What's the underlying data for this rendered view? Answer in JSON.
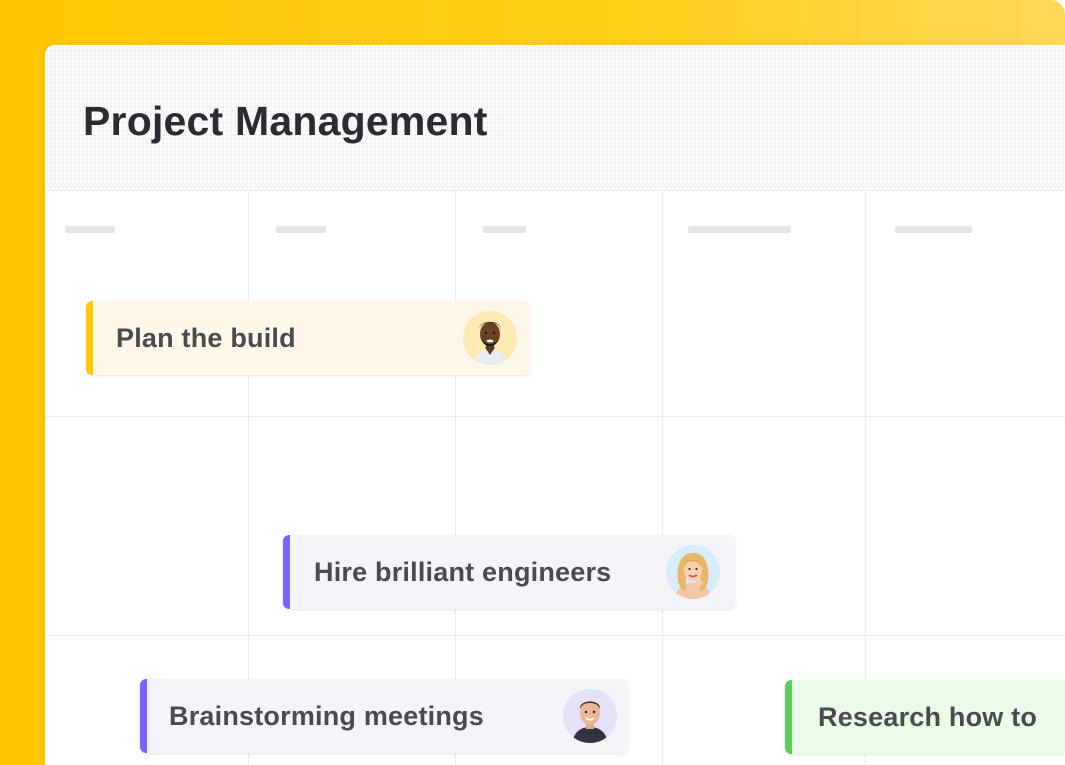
{
  "board": {
    "title": "Project Management"
  },
  "tasks": [
    {
      "label": "Plan the build",
      "accent": "#ffc800",
      "background": "#fff8e8",
      "assignee_icon": "avatar-man-dark-hair-beard"
    },
    {
      "label": "Hire brilliant engineers",
      "accent": "#7b61ff",
      "background": "#f5f4fb",
      "assignee_icon": "avatar-woman-blonde"
    },
    {
      "label": "Brainstorming meetings",
      "accent": "#7b61ff",
      "background": "#f5f4fb",
      "assignee_icon": "avatar-man-short-hair"
    },
    {
      "label": "Research how to",
      "accent": "#5dcc5a",
      "background": "#ecfbe8"
    }
  ],
  "colors": {
    "brand_yellow": "#ffc800",
    "title_text": "#2a2c33",
    "task_text": "#4a4b52"
  }
}
